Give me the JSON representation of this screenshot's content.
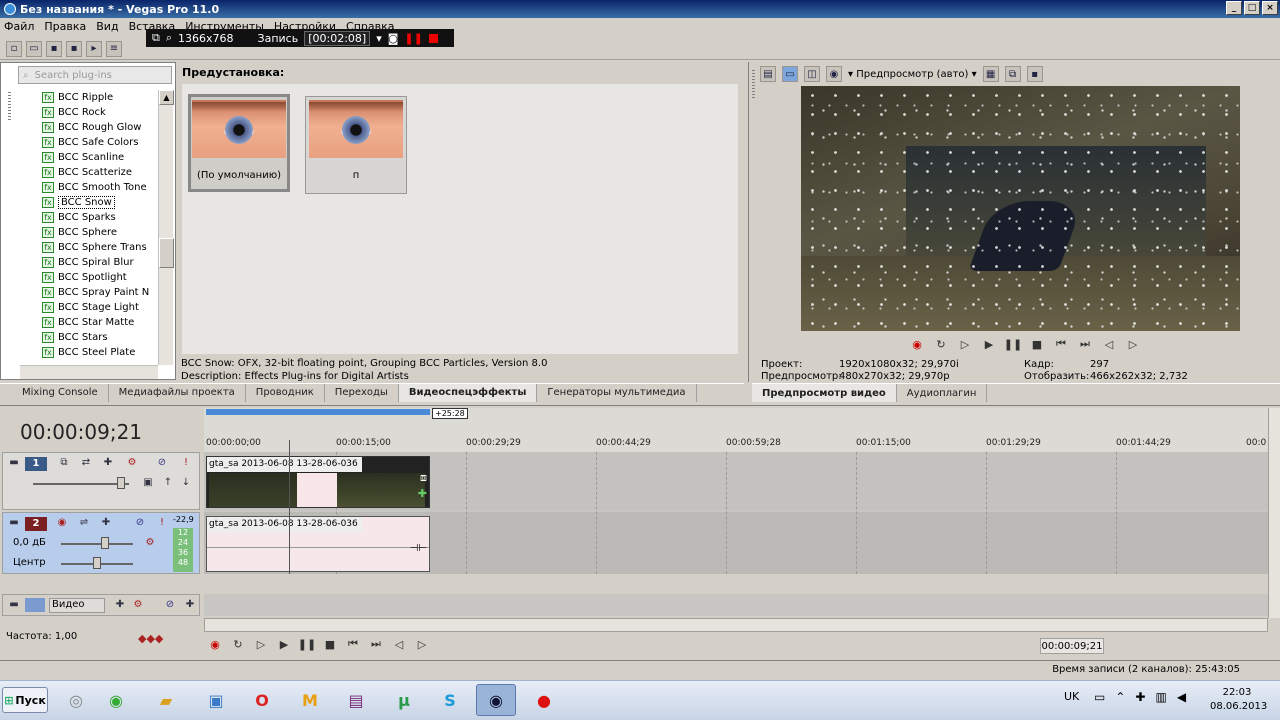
{
  "window": {
    "title": "Без названия * - Vegas Pro 11.0",
    "btn_min": "_",
    "btn_max": "□",
    "btn_close": "×"
  },
  "menu": [
    "Файл",
    "Правка",
    "Вид",
    "Вставка",
    "Инструменты",
    "Настройки",
    "Справка"
  ],
  "recorder": {
    "resolution": "1366x768",
    "label": "Запись",
    "time": "[00:02:08]"
  },
  "plugins": {
    "search_placeholder": "Search plug-ins",
    "items": [
      "BCC Ripple",
      "BCC Rock",
      "BCC Rough Glow",
      "BCC Safe Colors",
      "BCC Scanline",
      "BCC Scatterize",
      "BCC Smooth Tone",
      "BCC Snow",
      "BCC Sparks",
      "BCC Sphere",
      "BCC Sphere Trans",
      "BCC Spiral Blur",
      "BCC Spotlight",
      "BCC Spray Paint N",
      "BCC Stage Light",
      "BCC Star Matte",
      "BCC Stars",
      "BCC Steel Plate"
    ],
    "selected": "BCC Snow"
  },
  "presets": {
    "label": "Предустановка:",
    "items": [
      "(По умолчанию)",
      "п"
    ]
  },
  "description": {
    "line1": "BCC Snow: OFX, 32-bit floating point, Grouping BCC Particles, Version 8.0",
    "line2": "Description: Effects Plug-ins for Digital Artists"
  },
  "tabs": [
    "Mixing Console",
    "Медиафайлы проекта",
    "Проводник",
    "Переходы",
    "Видеоспецэффекты",
    "Генераторы мультимедиа"
  ],
  "active_tab": "Видеоспецэффекты",
  "preview": {
    "mode": "Предпросмотр (авто)",
    "project_k": "Проект:",
    "project_v": "1920x1080x32; 29,970i",
    "frame_k": "Кадр:",
    "frame_v": "297",
    "preview_k": "Предпросмотр:",
    "preview_v": "480x270x32; 29,970p",
    "display_k": "Отобразить:",
    "display_v": "466x262x32; 2,732",
    "tabs": [
      "Предпросмотр видео",
      "Аудиоплагин"
    ]
  },
  "timeline": {
    "timecode": "00:00:09;21",
    "marker": "+25:28",
    "ticks": [
      "00:00:00;00",
      "00:00:15;00",
      "00:00:29;29",
      "00:00:44;29",
      "00:00:59;28",
      "00:01:15;00",
      "00:01:29;29",
      "00:01:44;29",
      "00:0"
    ],
    "track1": {
      "num": "1"
    },
    "track2": {
      "num": "2",
      "volume": "0,0 дБ",
      "pan": "Центр",
      "level": "-22,9",
      "meter": [
        "12",
        "24",
        "36",
        "48"
      ]
    },
    "bus": {
      "label": "Видео"
    },
    "clip_name_video": "gta_sa 2013-06-08 13-28-06-036",
    "clip_name_audio": "gta_sa 2013-06-08 13-28-06-036",
    "rate": "Частота: 1,00",
    "cursor_time": "00:00:09;21"
  },
  "status": "Время записи (2 каналов): 25:43:05",
  "taskbar": {
    "start": "Пуск",
    "lang": "UK",
    "time": "22:03",
    "date": "08.06.2013"
  }
}
